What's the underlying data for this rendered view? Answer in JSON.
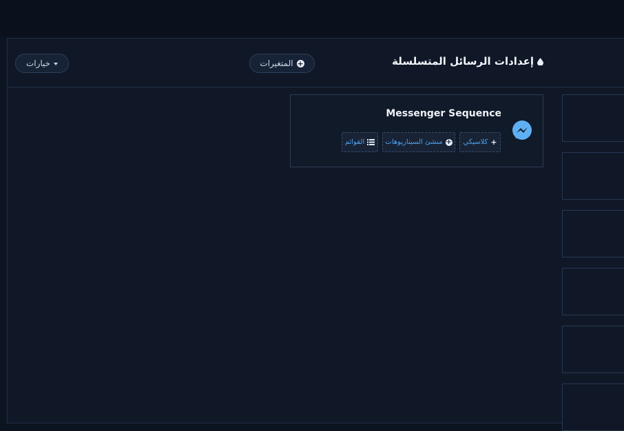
{
  "header": {
    "title": "إعدادات الرسائل المتسلسلة",
    "variables_label": "المتغيرات",
    "options_label": "خيارات"
  },
  "card": {
    "title": "Messenger Sequence",
    "actions": [
      {
        "label": "كلاسيكي",
        "icon": "plus-icon"
      },
      {
        "label": "منشئ السيناريوهات",
        "icon": "plus-circle-icon"
      },
      {
        "label": "القوائم",
        "icon": "list-icon"
      }
    ]
  },
  "icons": {
    "title": "drop-icon",
    "card": "messenger-icon"
  },
  "colors": {
    "accent": "#4ea2ee",
    "panel_bg": "#101827",
    "border": "#1f2f47"
  }
}
